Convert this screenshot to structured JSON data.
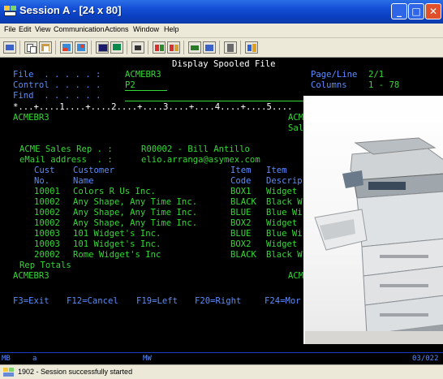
{
  "window": {
    "title": "Session A - [24 x 80]",
    "buttons": {
      "minimize": "_",
      "maximize": "□",
      "close": "✕"
    }
  },
  "menu": [
    "File",
    "Edit",
    "View",
    "Communication",
    "Actions",
    "Window",
    "Help"
  ],
  "toolbar": [
    "print-screen-icon",
    "copy-icon",
    "paste-icon",
    "send-file-icon",
    "receive-file-icon",
    "display-icon",
    "color-icon",
    "record-icon",
    "play-icon",
    "macro-icon",
    "start-macro-icon",
    "help-icon",
    "sessions-icon",
    "keypad-icon"
  ],
  "screen": {
    "title": "Display Spooled File",
    "file_label": "File  . . . . . :",
    "file_value": "ACMEBR3",
    "page_line_label": "Page/Line",
    "page_line_value": "2/1",
    "control_label": "Control . . . . .",
    "control_value": "P2",
    "columns_label": "Columns",
    "columns_value": "1 - 78",
    "find_label": "Find  . . . . . .",
    "ruler": "*...+....1....+....2....+....3....+....4....+....5....",
    "report_name": "ACMEBR3",
    "report_name_right": "ACM",
    "report_sub_right": "Sal",
    "sales_rep_label": "ACME Sales Rep . :",
    "sales_rep_value": "R00002 - Bill Antillo",
    "email_label": "eMail address  . :",
    "email_value": "elio.arranga@asymex.com",
    "headers_1": {
      "cust": "Cust",
      "customer": "Customer",
      "item": "Item",
      "item2": "Item"
    },
    "headers_2": {
      "no": "No.",
      "name": "Name",
      "code": "Code",
      "descrip": "Descrip"
    },
    "rows": [
      {
        "no": "10001",
        "name": "Colors R Us Inc.",
        "code": "BOX1",
        "desc": "Widget"
      },
      {
        "no": "10002",
        "name": "Any Shape, Any Time Inc.",
        "code": "BLACK",
        "desc": "Black W"
      },
      {
        "no": "10002",
        "name": "Any Shape, Any Time Inc.",
        "code": "BLUE",
        "desc": "Blue Wi"
      },
      {
        "no": "10002",
        "name": "Any Shape, Any Time Inc.",
        "code": "BOX2",
        "desc": "Widget"
      },
      {
        "no": "10003",
        "name": "101 Widget's Inc.",
        "code": "BLUE",
        "desc": "Blue Wi"
      },
      {
        "no": "10003",
        "name": "101 Widget's Inc.",
        "code": "BOX2",
        "desc": "Widget"
      },
      {
        "no": "20002",
        "name": "Rome Widget's Inc",
        "code": "BLACK",
        "desc": "Black W"
      }
    ],
    "rep_totals": "Rep Totals",
    "footer_name": "ACMEBR3",
    "footer_right": "ACM",
    "fkeys": [
      "F3=Exit",
      "F12=Cancel",
      "F19=Left",
      "F20=Right",
      "F24=Mor"
    ]
  },
  "oia": {
    "indicator": "MB",
    "session": "a",
    "mode": "MW",
    "cursor": "03/022"
  },
  "status": {
    "text": "1902 - Session successfully started"
  },
  "colors": {
    "terminal_bg": "#000000",
    "terminal_green": "#35d835",
    "terminal_blue": "#5a8cff",
    "titlebar": "#0a3fc0"
  }
}
